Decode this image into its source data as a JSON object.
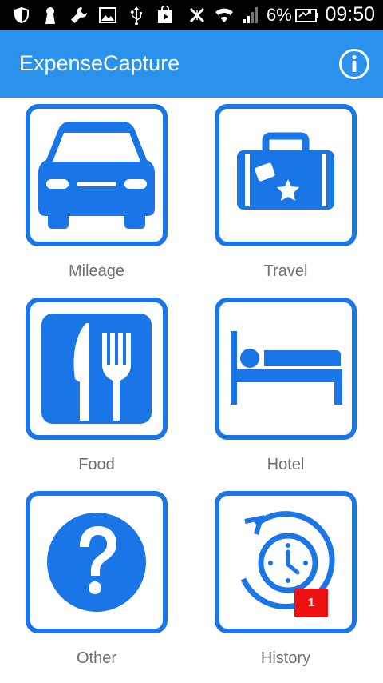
{
  "status_bar": {
    "battery_percent": "6%",
    "time": "09:50",
    "icons": [
      "shield-icon",
      "keyhole-icon",
      "wrench-icon",
      "image-icon",
      "usb-icon",
      "play-store-icon",
      "bluetooth-off-icon",
      "wifi-icon",
      "signal-icon",
      "battery-icon"
    ]
  },
  "app_bar": {
    "title": "ExpenseCapture",
    "info_icon": "info-icon"
  },
  "tiles": [
    {
      "label": "Mileage",
      "icon": "car-icon"
    },
    {
      "label": "Travel",
      "icon": "suitcase-icon"
    },
    {
      "label": "Food",
      "icon": "fork-knife-icon"
    },
    {
      "label": "Hotel",
      "icon": "bed-icon"
    },
    {
      "label": "Other",
      "icon": "question-icon"
    },
    {
      "label": "History",
      "icon": "history-clock-icon",
      "badge": "1"
    }
  ],
  "colors": {
    "app_bar": "#2a92ec",
    "tile_accent": "#1a75e6",
    "badge": "#ee1111",
    "label_text": "#6f6f6f"
  }
}
